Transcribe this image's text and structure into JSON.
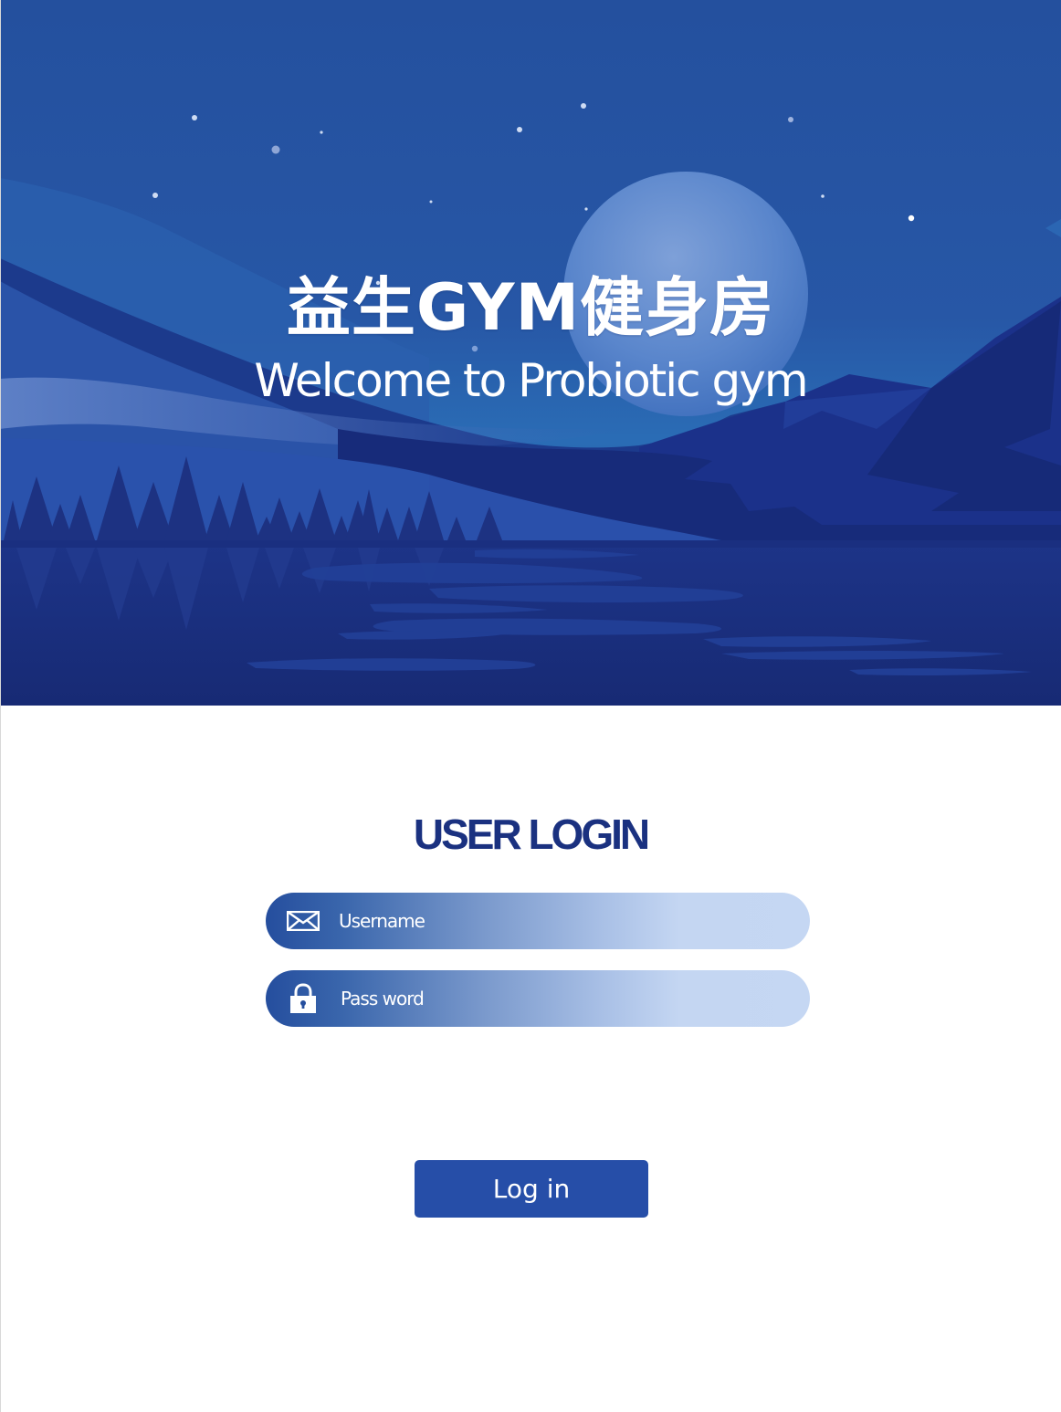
{
  "hero": {
    "title": "益生GYM健身房",
    "subtitle": "Welcome to Probiotic gym"
  },
  "login": {
    "heading": "USER LOGIN",
    "username": {
      "icon": "envelope-icon",
      "placeholder": "Username",
      "value": ""
    },
    "password": {
      "icon": "lock-icon",
      "placeholder": "Pass word",
      "value": ""
    },
    "button_label": "Log in"
  },
  "colors": {
    "sky_top": "#2450a0",
    "moon": "#5b8ad0",
    "mountain_dark": "#1a2d7e",
    "lake": "#1c3286",
    "heading": "#1a3180",
    "field_gradient_start": "#254e9e",
    "field_gradient_end": "#c5d7f3",
    "button": "#264ea8"
  }
}
